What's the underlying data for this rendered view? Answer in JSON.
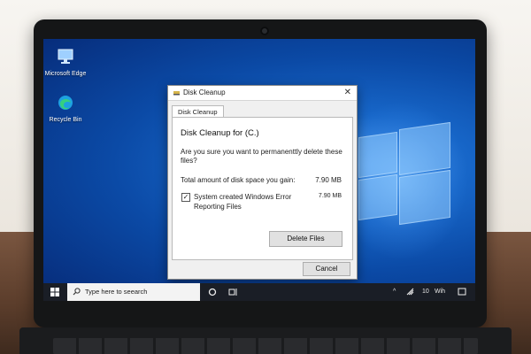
{
  "desktop": {
    "icons": [
      {
        "label": "Microsoft Edge",
        "icon": "monitor-icon"
      },
      {
        "label": "Recycle Bin",
        "icon": "edge-icon"
      }
    ]
  },
  "dialog": {
    "title": "Disk Cleanup",
    "tab_label": "Disk Cleanup",
    "heading": "Disk Cleanup  for (C.)",
    "question": "Are you sure you want to permanenttly delete these files?",
    "gain_label": "Total amount of disk space you gain:",
    "gain_value": "7.90 MB",
    "item": {
      "label": "System created Windows Error Reporting Files",
      "size": "7.90 MB",
      "checked": "✓"
    },
    "delete_label": "Delete Files",
    "cancel_label": "Cancel",
    "close_glyph": "✕"
  },
  "taskbar": {
    "search_placeholder": "Type here to seearch",
    "tray_number": "10",
    "tray_text": "Wih"
  }
}
